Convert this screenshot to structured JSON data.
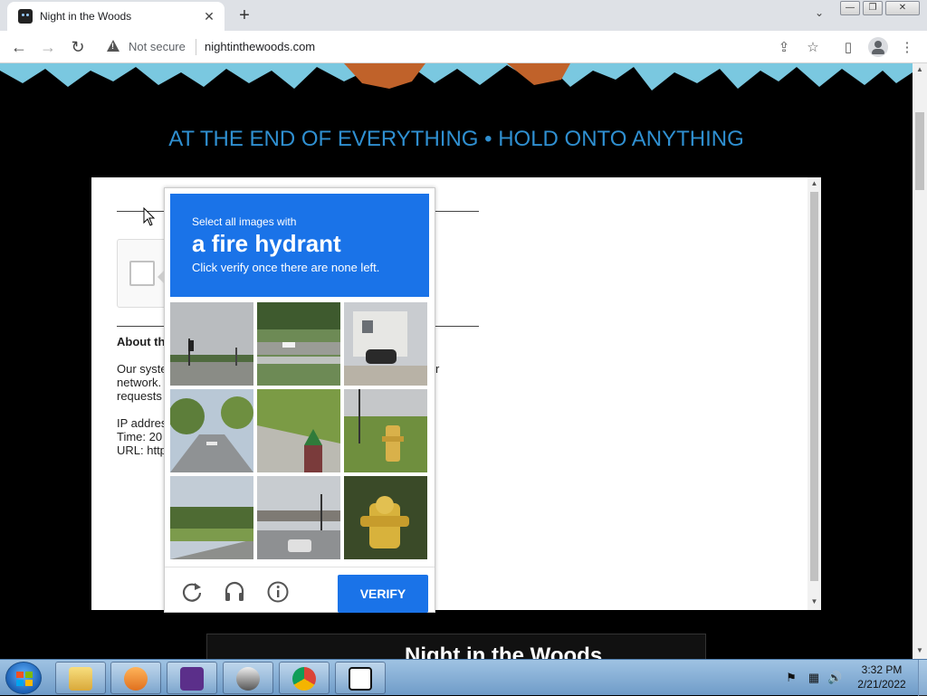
{
  "browser": {
    "tab_title": "Night in the Woods",
    "tab_close": "✕",
    "new_tab": "+",
    "tab_search": "⌄",
    "window_controls": {
      "minimize": "—",
      "maximize": "❐",
      "close": "✕"
    },
    "nav": {
      "back": "←",
      "forward": "→",
      "reload": "↻"
    },
    "security_label": "Not secure",
    "url": "nightinthewoods.com",
    "toolbar_icons": {
      "share": "⇪",
      "bookmark": "☆",
      "sidebar": "▯",
      "menu": "⋮"
    }
  },
  "page": {
    "tagline": "AT THE END OF EVERYTHING • HOLD ONTO ANYTHING",
    "about_title": "About th",
    "info_lines": [
      "Our syste",
      "network.",
      "requests",
      "IP addres",
      "Time: 20",
      "URL: http"
    ],
    "info_fragment_right": "r",
    "bottom_card_title": "Night in the Woods"
  },
  "captcha": {
    "instruction_small": "Select all images with",
    "target_object": "a fire hydrant",
    "instruction_sub": "Click verify once there are none left.",
    "verify_label": "VERIFY",
    "footer_icons": [
      "reload-icon",
      "audio-icon",
      "info-icon"
    ],
    "tiles": [
      {
        "name": "tile-road-traffic-light",
        "has_hydrant": false
      },
      {
        "name": "tile-highway-car",
        "has_hydrant": false
      },
      {
        "name": "tile-house-parked-car",
        "has_hydrant": false
      },
      {
        "name": "tile-street-trees",
        "has_hydrant": false
      },
      {
        "name": "tile-green-hydrant",
        "has_hydrant": true
      },
      {
        "name": "tile-yellow-hydrant",
        "has_hydrant": true
      },
      {
        "name": "tile-road-field",
        "has_hydrant": false
      },
      {
        "name": "tile-intersection-train",
        "has_hydrant": false
      },
      {
        "name": "tile-yellow-hydrant-closeup",
        "has_hydrant": true
      }
    ]
  },
  "taskbar": {
    "apps": [
      "explorer-app",
      "media-player-app",
      "night-in-the-woods-app",
      "anonymous-app",
      "chrome-app",
      "7zip-app"
    ],
    "tray": {
      "flag": "⚑",
      "network": "▦",
      "volume": "🔊"
    },
    "clock_time": "3:32 PM",
    "clock_date": "2/21/2022"
  },
  "scroll": {
    "up": "▲",
    "down": "▼"
  }
}
